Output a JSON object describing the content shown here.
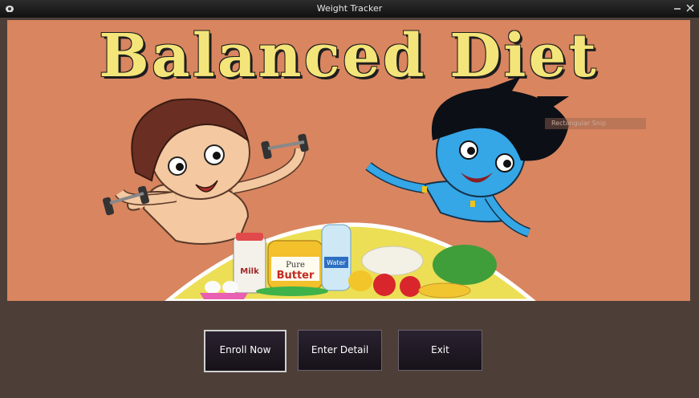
{
  "window": {
    "title": "Weight Tracker"
  },
  "banner": {
    "title": "Balanced Diet",
    "labels": {
      "milk": "Milk",
      "butter_top": "Pure",
      "butter_bottom": "Butter",
      "water": "Water"
    },
    "snip_tag": "Rectangular Snip"
  },
  "buttons": {
    "enroll": "Enroll Now",
    "detail": "Enter Detail",
    "exit": "Exit"
  },
  "colors": {
    "banner_bg": "#d9855f",
    "title_yellow": "#f4e57a",
    "plate_yellow": "#ecdf55",
    "frame_brown": "#4d3f38"
  }
}
